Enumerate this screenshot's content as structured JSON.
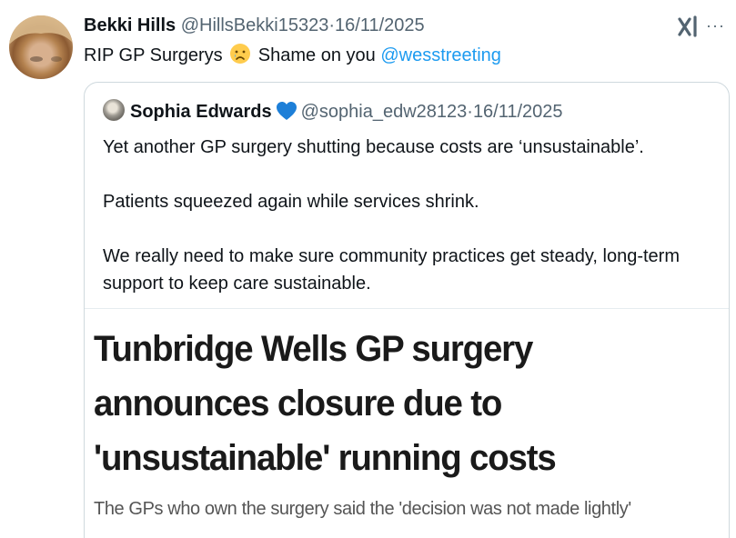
{
  "tweet": {
    "author_name": "Bekki Hills",
    "author_handle": "@HillsBekki15323",
    "separator": "·",
    "date": "16/11/2025",
    "text_before": "RIP GP Surgerys",
    "emoji_icon": "crying-face-icon",
    "text_after": "Shame on you",
    "mention": "@wesstreeting",
    "more_icon": "more-options-icon",
    "more_label": "···",
    "brand_icon": "grok-logo-icon"
  },
  "quote": {
    "author_name": "Sophia Edwards",
    "badge_icon": "blue-heart-icon",
    "author_handle": "@sophia_edw28123",
    "separator": "·",
    "date": "16/11/2025",
    "paragraphs": [
      "Yet another GP surgery shutting because costs are ‘unsustainable’.",
      "Patients squeezed again while services shrink.",
      "We really need to make sure community practices get steady, long-term support to keep care sustainable."
    ],
    "media": {
      "headline": "Tunbridge Wells GP surgery announces closure due to 'unsustainable' running costs",
      "subhead": "The GPs who own the surgery said the 'decision was not made lightly'"
    }
  },
  "colors": {
    "text": "#0f1419",
    "secondary": "#536471",
    "link": "#1d9bf0",
    "border": "#cfd9de"
  }
}
